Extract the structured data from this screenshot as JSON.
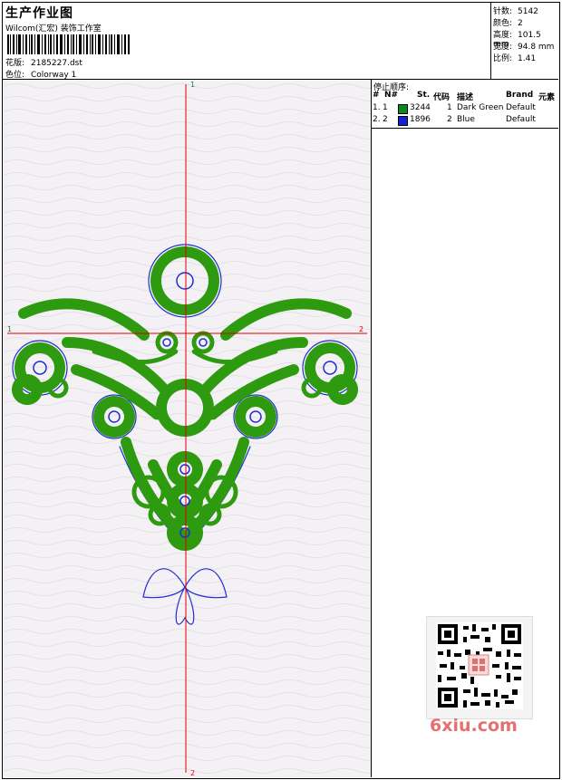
{
  "header": {
    "title": "生产作业图",
    "subtitle": "Wilcom(汇宏) 装饰工作室",
    "pattern_label": "花版:",
    "pattern_value": "2185227.dst",
    "colorway_label": "色位:",
    "colorway_value": "Colorway 1"
  },
  "stats": [
    {
      "label": "针数:",
      "value": "5142"
    },
    {
      "label": "颜色:",
      "value": "2"
    },
    {
      "label": "高度:",
      "value": "101.5 mm"
    },
    {
      "label": "宽度:",
      "value": "94.8 mm"
    },
    {
      "label": "比例:",
      "value": "1.41"
    }
  ],
  "sequence": {
    "caption": "停止顺序:",
    "headers": [
      "#",
      "N#",
      "St.",
      "代码",
      "描述",
      "Brand",
      "元素"
    ],
    "rows": [
      {
        "n": "1.",
        "nn": "1",
        "st": "3244",
        "code": "1",
        "desc": "Dark Green",
        "brand": "Default",
        "color": "#0a8a1e"
      },
      {
        "n": "2.",
        "nn": "2",
        "st": "1896",
        "code": "2",
        "desc": "Blue",
        "brand": "Default",
        "color": "#1020d8"
      }
    ]
  },
  "axis_labels": {
    "top": "1",
    "bottom": "2",
    "left": "1",
    "right": "2"
  },
  "watermark": "6xiu.com",
  "colors": {
    "thread_green": "#2e9a10",
    "thread_blue": "#1f2fcf",
    "axis_red": "#e00000"
  }
}
